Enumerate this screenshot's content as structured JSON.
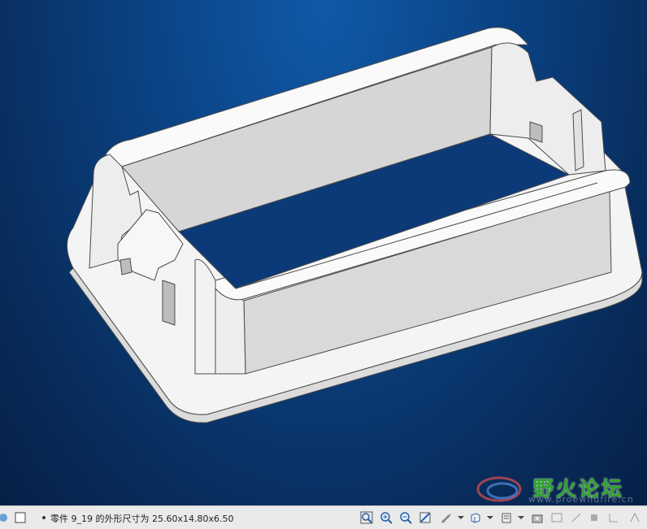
{
  "status": {
    "message": "零件 9_19 的外形尺寸为 25.60x14.80x6.50"
  },
  "watermark": {
    "logo_text": "野火论坛",
    "url": "www.proewildfire.cn"
  },
  "toolbar": {
    "icons": [
      "zoom-fit-icon",
      "zoom-in-icon",
      "zoom-out-icon",
      "repaint-icon",
      "spin-center-icon",
      "view-orient-icon",
      "layers-icon",
      "saved-views-icon",
      "datum-display-icon"
    ]
  },
  "colors": {
    "background_top": "#0f5aa8",
    "background_bottom": "#062046",
    "part_face_light": "#ffffff",
    "part_face_mid": "#e8e8e8",
    "part_face_dark": "#d0d0d0",
    "edge": "#555555",
    "watermark_green": "#2ea32a"
  }
}
